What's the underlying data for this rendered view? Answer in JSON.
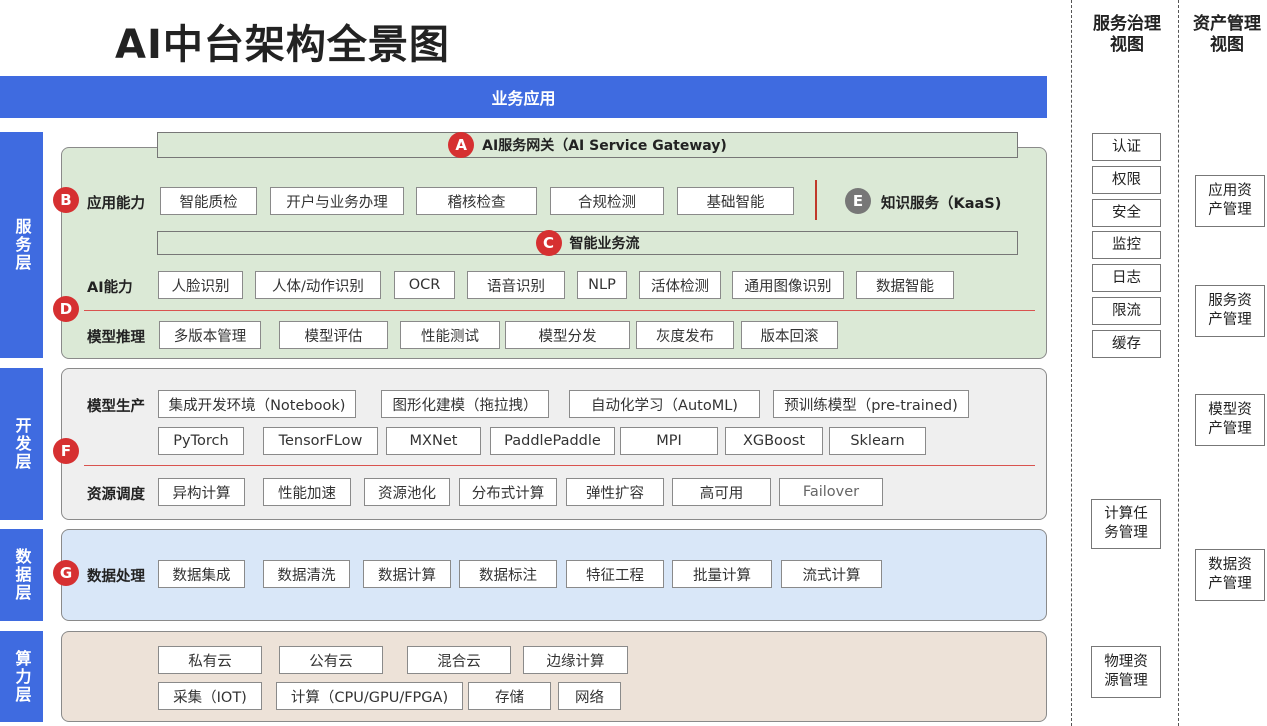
{
  "title": "AI中台架构全景图",
  "business_app": "业务应用",
  "layers": {
    "service": "服务层",
    "dev": "开发层",
    "data": "数据层",
    "compute": "算力层"
  },
  "service": {
    "gateway": {
      "badge": "A",
      "label": "AI服务网关（AI Service Gateway)"
    },
    "app_ability": {
      "badge": "B",
      "label": "应用能力",
      "items": [
        "智能质检",
        "开户与业务办理",
        "稽核检查",
        "合规检测",
        "基础智能"
      ]
    },
    "knowledge": {
      "badge": "E",
      "label": "知识服务（KaaS)"
    },
    "flow": {
      "badge": "C",
      "label": "智能业务流"
    },
    "ai_ability": {
      "label": "AI能力",
      "items": [
        "人脸识别",
        "人体/动作识别",
        "OCR",
        "语音识别",
        "NLP",
        "活体检测",
        "通用图像识别",
        "数据智能"
      ]
    },
    "inference": {
      "badge": "D",
      "label": "模型推理",
      "items": [
        "多版本管理",
        "模型评估",
        "性能测试",
        "模型分发",
        "灰度发布",
        "版本回滚"
      ]
    }
  },
  "dev": {
    "badge": "F",
    "model_prod": {
      "label": "模型生产",
      "row1": [
        "集成开发环境（Notebook)",
        "图形化建模（拖拉拽）",
        "自动化学习（AutoML)",
        "预训练模型（pre-trained)"
      ],
      "row2": [
        "PyTorch",
        "TensorFLow",
        "MXNet",
        "PaddlePaddle",
        "MPI",
        "XGBoost",
        "Sklearn"
      ]
    },
    "scheduling": {
      "label": "资源调度",
      "items": [
        "异构计算",
        "性能加速",
        "资源池化",
        "分布式计算",
        "弹性扩容",
        "高可用",
        "Failover"
      ]
    }
  },
  "data_layer": {
    "badge": "G",
    "label": "数据处理",
    "items": [
      "数据集成",
      "数据清洗",
      "数据计算",
      "数据标注",
      "特征工程",
      "批量计算",
      "流式计算"
    ]
  },
  "compute": {
    "row1": [
      "私有云",
      "公有云",
      "混合云",
      "边缘计算"
    ],
    "row2": [
      "采集（IOT)",
      "计算（CPU/GPU/FPGA)",
      "存储",
      "网络"
    ]
  },
  "governance_view": {
    "title": "服务治理视图",
    "items": [
      "认证",
      "权限",
      "安全",
      "监控",
      "日志",
      "限流",
      "缓存"
    ],
    "compute_task": "计算任务管理",
    "physical": "物理资源管理"
  },
  "asset_view": {
    "title": "资产管理视图",
    "items": [
      "应用资产管理",
      "服务资产管理",
      "模型资产管理",
      "数据资产管理"
    ]
  },
  "colors": {
    "primary_blue": "#3f6be0",
    "badge_red": "#d63031",
    "badge_grey": "#777777",
    "service_bg": "#dbe9d6",
    "dev_bg": "#efefef",
    "data_bg": "#d9e7f8",
    "compute_bg": "#ede2d8"
  }
}
